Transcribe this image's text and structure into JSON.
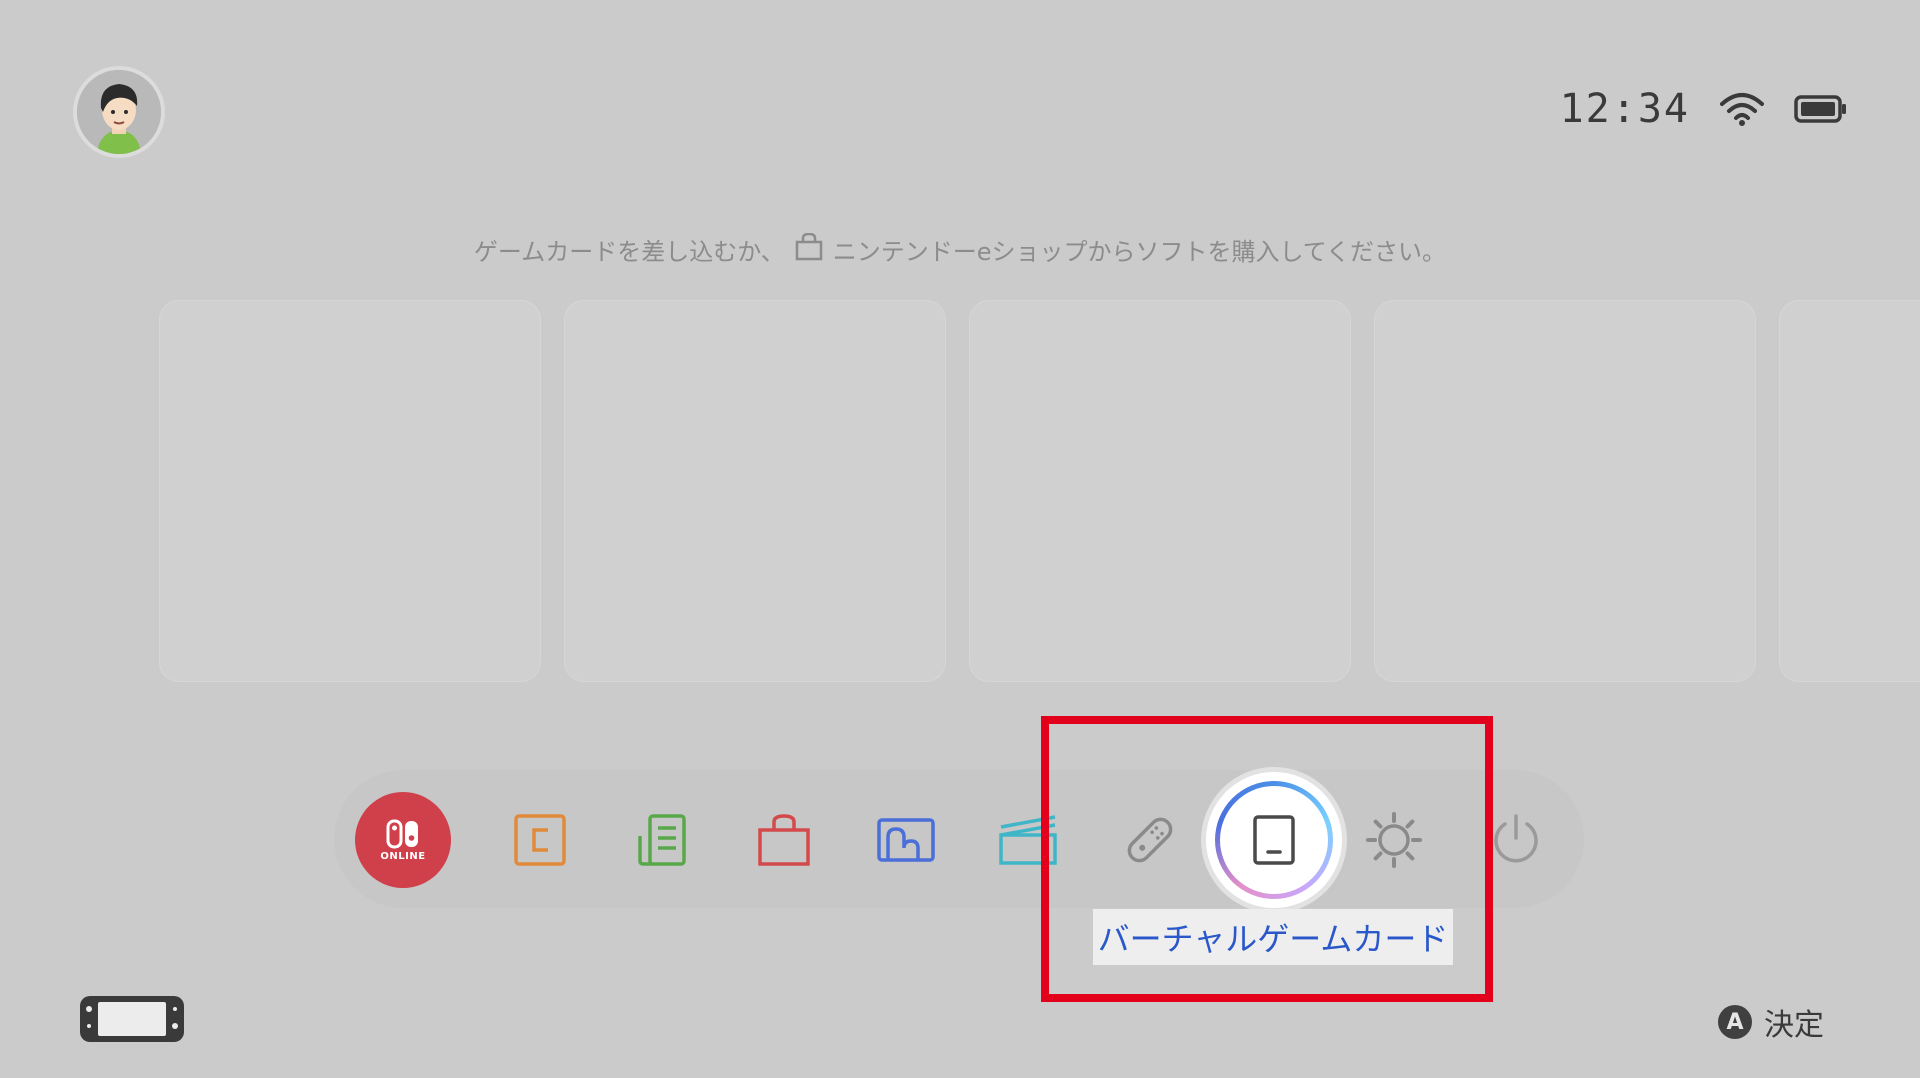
{
  "status": {
    "time": "12:34"
  },
  "hint": {
    "text_before": "ゲームカードを差し込むか、",
    "text_after": "ニンテンドーeショップからソフトを購入してください。"
  },
  "dock": {
    "items": [
      {
        "key": "online",
        "label": "ONLINE",
        "icon": "nintendo-switch-online-icon",
        "color": "#d0404a"
      },
      {
        "key": "news",
        "icon": "news-icon",
        "color": "#e08a3a"
      },
      {
        "key": "catalog",
        "icon": "list-icon",
        "color": "#58a84a"
      },
      {
        "key": "eshop",
        "icon": "shopping-bag-icon",
        "color": "#d44a4a"
      },
      {
        "key": "album",
        "icon": "album-icon",
        "color": "#4a6fd8"
      },
      {
        "key": "game-share",
        "icon": "stack-icon",
        "color": "#3fb6c8"
      },
      {
        "key": "controllers",
        "icon": "joycon-icon",
        "color": "#8a8a8a"
      },
      {
        "key": "virtual-game-card",
        "icon": "virtual-game-card-icon",
        "selected": true
      },
      {
        "key": "settings",
        "icon": "gear-icon",
        "color": "#8a8a8a"
      },
      {
        "key": "power",
        "icon": "power-icon",
        "color": "#9a9a9a"
      }
    ],
    "selected_label": "バーチャルゲームカード"
  },
  "footer": {
    "confirm_button": "A",
    "confirm_label": "決定"
  },
  "colors": {
    "background": "#cbcbcb",
    "highlight": "#e3001b",
    "selected_text": "#2a57c9"
  }
}
